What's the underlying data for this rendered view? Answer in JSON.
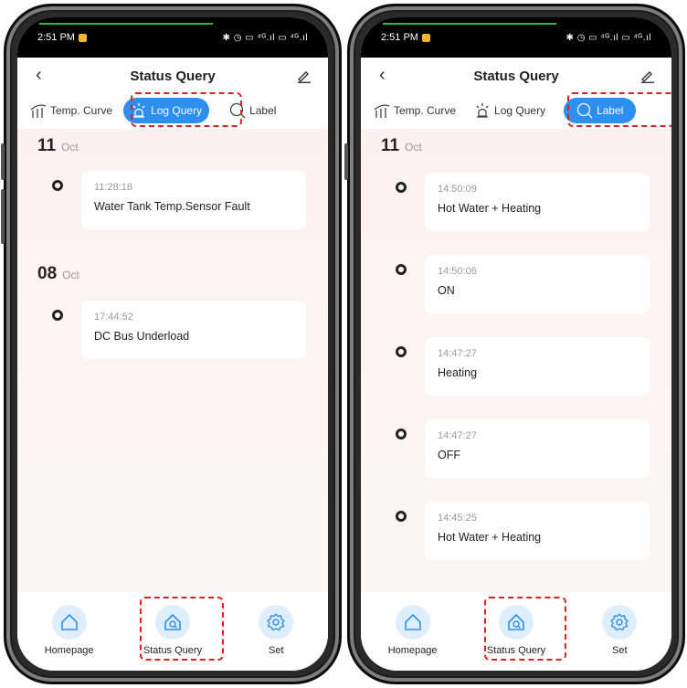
{
  "status_bar": {
    "time": "2:51 PM",
    "indicators": "✱ ◷ ▭ ⁴ᴳ.ıl ▭ ⁴ᴳ.ıl"
  },
  "header": {
    "title": "Status Query",
    "back_icon": "back-chevron-icon",
    "edit_icon": "pencil-icon"
  },
  "tabs": [
    {
      "label": "Temp. Curve",
      "icon": "temperature-curve-icon"
    },
    {
      "label": "Log Query",
      "icon": "alarm-light-icon"
    },
    {
      "label": "Label",
      "icon": "search-icon"
    }
  ],
  "screens": [
    {
      "active_tab": "Log Query",
      "groups": [
        {
          "day": "11",
          "month": "Oct",
          "entries": [
            {
              "time": "11:28:18",
              "text": "Water Tank Temp.Sensor Fault"
            }
          ]
        },
        {
          "day": "08",
          "month": "Oct",
          "entries": [
            {
              "time": "17:44:52",
              "text": "DC Bus Underload"
            }
          ]
        }
      ]
    },
    {
      "active_tab": "Label",
      "groups": [
        {
          "day": "11",
          "month": "Oct",
          "entries": [
            {
              "time": "14:50:09",
              "text": "Hot Water + Heating"
            },
            {
              "time": "14:50:06",
              "text": "ON"
            },
            {
              "time": "14:47:27",
              "text": "Heating"
            },
            {
              "time": "14:47:27",
              "text": "OFF"
            },
            {
              "time": "14:45:25",
              "text": "Hot Water + Heating"
            }
          ]
        }
      ]
    }
  ],
  "bottom_nav": [
    {
      "label": "Homepage",
      "icon": "home-icon"
    },
    {
      "label": "Status Query",
      "icon": "status-query-icon"
    },
    {
      "label": "Set",
      "icon": "gear-icon"
    }
  ],
  "colors": {
    "accent": "#2d8ff0",
    "highlight": "#e02020",
    "nav_circle": "#dfeefc",
    "content_bg": "#fcf1f1"
  }
}
